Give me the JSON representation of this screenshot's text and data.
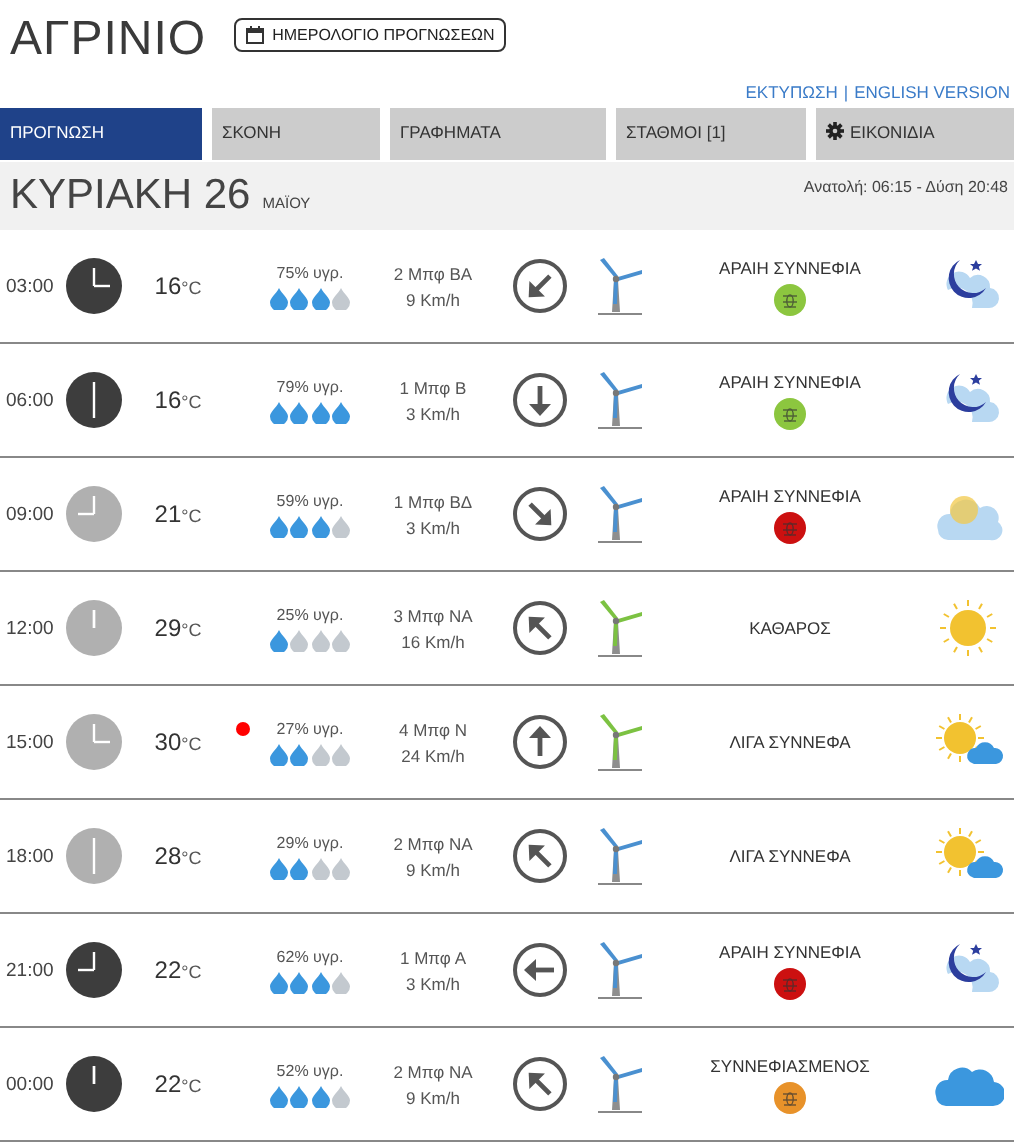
{
  "header": {
    "city": "ΑΓΡΙΝΙΟ",
    "calendar_button": "ΗΜΕΡΟΛΟΓΙΟ ΠΡΟΓΝΩΣΕΩΝ",
    "links": [
      "ΕΚΤΥΠΩΣΗ",
      "ENGLISH VERSION"
    ],
    "link_separator": "|"
  },
  "tabs": [
    {
      "label": "ΠΡΟΓΝΩΣΗ",
      "selected": true,
      "kind": "plain"
    },
    {
      "label": "ΣΚΟΝΗ",
      "selected": false,
      "kind": "plain"
    },
    {
      "label": "ΓΡΑΦΗΜΑΤΑ",
      "selected": false,
      "kind": "plain"
    },
    {
      "label": "ΣΤΑΘΜΟΙ [1]",
      "selected": false,
      "kind": "plain"
    },
    {
      "label": "ΕΙΚΟΝΙΔΙΑ",
      "selected": false,
      "kind": "gear"
    }
  ],
  "day": {
    "date": "ΚΥΡΙΑΚΗ 26",
    "month": "ΜΑΪΟΥ",
    "sun": "Ανατολή: 06:15 - Δύση 20:48"
  },
  "rows": [
    {
      "time": "03:00",
      "night": true,
      "clock": {
        "kind": "right"
      },
      "temp": "16",
      "unit": "°C",
      "hot": false,
      "humidity": "75% υγρ.",
      "stars": 3,
      "beaufort": "2 Μπφ ΒΑ",
      "speed": "9 Km/h",
      "arrow": {
        "kind": "sw"
      },
      "turbine": {
        "color": "#4a90d0"
      },
      "condition": "ΑΡΑΙΗ ΣΥΝΝΕΦΙΑ",
      "insect": {
        "color": "#8cc63f"
      },
      "weather": {
        "kind": "moon-cloud"
      }
    },
    {
      "time": "06:00",
      "night": true,
      "clock": {
        "kind": "down"
      },
      "temp": "16",
      "unit": "°C",
      "hot": false,
      "humidity": "79% υγρ.",
      "stars": 4,
      "beaufort": "1 Μπφ Β",
      "speed": "3 Km/h",
      "arrow": {
        "kind": "s"
      },
      "turbine": {
        "color": "#4a90d0"
      },
      "condition": "ΑΡΑΙΗ ΣΥΝΝΕΦΙΑ",
      "insect": {
        "color": "#8cc63f"
      },
      "weather": {
        "kind": "moon-cloud"
      }
    },
    {
      "time": "09:00",
      "night": false,
      "clock": {
        "kind": "left"
      },
      "temp": "21",
      "unit": "°C",
      "hot": false,
      "humidity": "59% υγρ.",
      "stars": 3,
      "beaufort": "1 Μπφ ΒΔ",
      "speed": "3 Km/h",
      "arrow": {
        "kind": "se"
      },
      "turbine": {
        "color": "#4a90d0"
      },
      "condition": "ΑΡΑΙΗ ΣΥΝΝΕΦΙΑ",
      "insect": {
        "color": "#cc1010"
      },
      "weather": {
        "kind": "sun-behind-cloud"
      }
    },
    {
      "time": "12:00",
      "night": false,
      "clock": {
        "kind": "up"
      },
      "temp": "29",
      "unit": "°C",
      "hot": false,
      "humidity": "25% υγρ.",
      "stars": 1,
      "beaufort": "3 Μπφ ΝΑ",
      "speed": "16 Km/h",
      "arrow": {
        "kind": "nw"
      },
      "turbine": {
        "color": "#7cc242"
      },
      "condition": "ΚΑΘΑΡΟΣ",
      "weather": {
        "kind": "sun"
      }
    },
    {
      "time": "15:00",
      "night": false,
      "clock": {
        "kind": "right"
      },
      "temp": "30",
      "unit": "°C",
      "hot": true,
      "humidity": "27% υγρ.",
      "stars": 2,
      "beaufort": "4 Μπφ Ν",
      "speed": "24 Km/h",
      "arrow": {
        "kind": "n"
      },
      "turbine": {
        "color": "#7cc242"
      },
      "condition": "ΛΙΓΑ ΣΥΝΝΕΦΑ",
      "weather": {
        "kind": "sun-cloud"
      }
    },
    {
      "time": "18:00",
      "night": false,
      "clock": {
        "kind": "down"
      },
      "temp": "28",
      "unit": "°C",
      "hot": false,
      "humidity": "29% υγρ.",
      "stars": 2,
      "beaufort": "2 Μπφ ΝΑ",
      "speed": "9 Km/h",
      "arrow": {
        "kind": "nw"
      },
      "turbine": {
        "color": "#4a90d0"
      },
      "condition": "ΛΙΓΑ ΣΥΝΝΕΦΑ",
      "weather": {
        "kind": "sun-cloud"
      }
    },
    {
      "time": "21:00",
      "night": true,
      "clock": {
        "kind": "left"
      },
      "temp": "22",
      "unit": "°C",
      "hot": false,
      "humidity": "62% υγρ.",
      "stars": 3,
      "beaufort": "1 Μπφ Α",
      "speed": "3 Km/h",
      "arrow": {
        "kind": "w"
      },
      "turbine": {
        "color": "#4a90d0"
      },
      "condition": "ΑΡΑΙΗ ΣΥΝΝΕΦΙΑ",
      "insect": {
        "color": "#cc1010"
      },
      "weather": {
        "kind": "moon-cloud"
      }
    },
    {
      "time": "00:00",
      "night": true,
      "clock": {
        "kind": "up"
      },
      "temp": "22",
      "unit": "°C",
      "hot": false,
      "humidity": "52% υγρ.",
      "stars": 3,
      "beaufort": "2 Μπφ ΝΑ",
      "speed": "9 Km/h",
      "arrow": {
        "kind": "nw"
      },
      "turbine": {
        "color": "#4a90d0"
      },
      "condition": "ΣΥΝΝΕΦΙΑΣΜΕΝΟΣ",
      "insect": {
        "color": "#e8922a"
      },
      "weather": {
        "kind": "cloud"
      }
    }
  ]
}
